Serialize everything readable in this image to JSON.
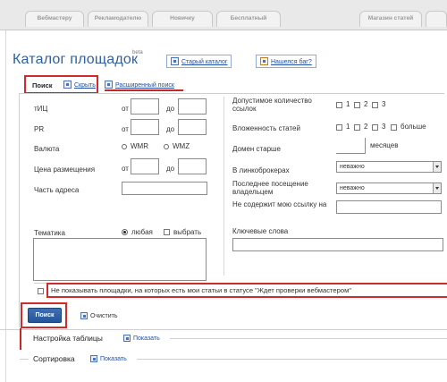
{
  "top_tabs": [
    "Вебмастеру",
    "Рекламодателю",
    "Новичку",
    "Бесплатный",
    "Магазин статей"
  ],
  "page": {
    "title": "Каталог площадок",
    "beta": "beta"
  },
  "header_links": {
    "old_catalog": "Старый каталог",
    "found_bug": "Нашелся баг?"
  },
  "tabs": {
    "search": "Поиск",
    "hide": "Скрыть",
    "advanced": "Расширенный поиск"
  },
  "form": {
    "tic": "тИЦ",
    "pr": "PR",
    "from": "от",
    "to": "до",
    "currency": "Валюта",
    "wmr": "WMR",
    "wmz": "WMZ",
    "price": "Цена размещения",
    "address_part": "Часть адреса",
    "thematic": "Тематика",
    "any": "любая",
    "choose": "выбрать",
    "allowed_links": "Допустимое количество ссылок",
    "nesting": "Вложенность статей",
    "domain_older": "Домен старше",
    "months": "месяцев",
    "in_linkbrokers": "В линкоброкерах",
    "last_visit": "Последнее посещение владельцем",
    "no_my_link": "Не содержит мою ссылку на",
    "keywords": "Ключевые слова",
    "no_matter": "неважно",
    "more": "больше",
    "nums": [
      "1",
      "2",
      "3"
    ],
    "dont_show": "Не показывать площадки, на которых есть мои статьи в статусе \"Ждет проверки вебмастером\""
  },
  "actions": {
    "search_button": "Поиск",
    "clear": "Очистить"
  },
  "sections": {
    "table_settings": "Настройка таблицы",
    "show": "Показать",
    "sorting": "Сортировка"
  }
}
